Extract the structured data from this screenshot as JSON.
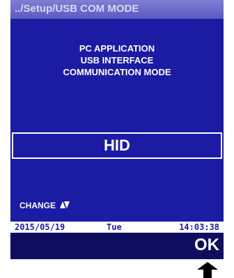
{
  "title_path": "../Setup/USB COM MODE",
  "description": [
    "PC APPLICATION",
    "USB INTERFACE",
    "COMMUNICATION MODE"
  ],
  "mode_value": "HID",
  "change_hint": "CHANGE",
  "change_icon": "up-down-triangle-icon",
  "status": {
    "date": "2015/05/19",
    "day": "Tue",
    "time": "14:03:38"
  },
  "softkey": {
    "label": "OK"
  },
  "indicator_icon": "up-arrow-icon",
  "colors": {
    "screen_background": "#1c1ba3",
    "titlebar": "#5a5ac2",
    "softkey_bar": "#0f0e5e",
    "text": "#ffffff"
  }
}
